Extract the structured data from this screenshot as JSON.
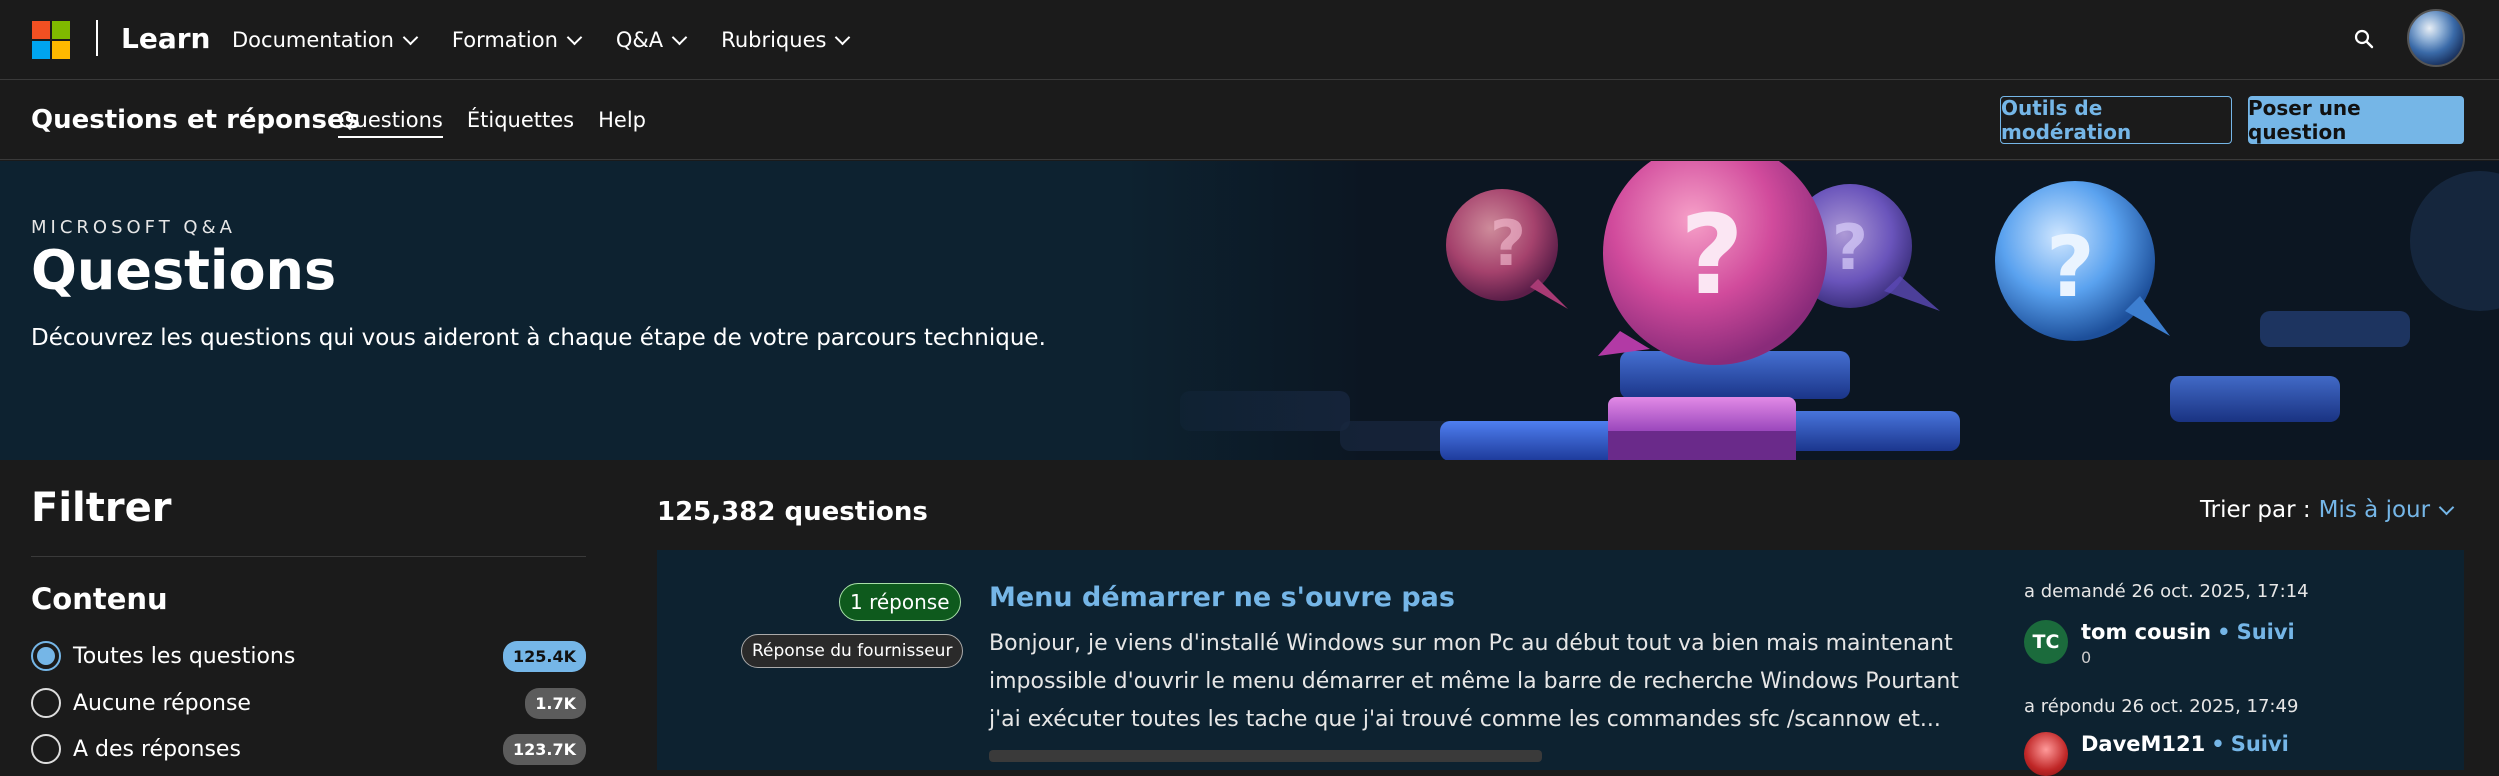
{
  "header": {
    "brand": "Learn",
    "logo_colors": [
      "#f25022",
      "#7fba00",
      "#00a4ef",
      "#ffb900"
    ],
    "nav": [
      {
        "label": "Documentation"
      },
      {
        "label": "Formation"
      },
      {
        "label": "Q&A"
      },
      {
        "label": "Rubriques"
      }
    ],
    "search_icon": "search-icon",
    "avatar": "avatar"
  },
  "subheader": {
    "title": "Questions et réponses",
    "tabs": [
      {
        "label": "Questions"
      },
      {
        "label": "Étiquettes"
      },
      {
        "label": "Help"
      }
    ],
    "moderation_button": "Outils de modération",
    "ask_button": "Poser une question"
  },
  "hero": {
    "eyebrow": "MICROSOFT Q&A",
    "title": "Questions",
    "description": "Découvrez les questions qui vous aideront à chaque étape de votre parcours technique."
  },
  "filter": {
    "title": "Filtrer",
    "section_title": "Contenu",
    "options": [
      {
        "label": "Toutes les questions",
        "count": "125.4K",
        "checked": true
      },
      {
        "label": "Aucune réponse",
        "count": "1.7K",
        "checked": false
      },
      {
        "label": "A des réponses",
        "count": "123.7K",
        "checked": false
      }
    ]
  },
  "results": {
    "count_label": "125,382 questions",
    "sort_label": "Trier par :",
    "sort_value": "Mis à jour"
  },
  "question": {
    "answers_badge": "1 réponse",
    "vendor_badge": "Réponse du fournisseur",
    "title": "Menu démarrer ne s'ouvre pas",
    "excerpt": "Bonjour, je viens d'installé Windows sur mon Pc au début tout va bien mais maintenant impossible d'ouvrir le menu démarrer et même la barre de recherche Windows Pourtant j'ai exécuter toutes les tache que j'ai trouvé comme les commandes sfc /scannow et...",
    "asked": "a demandé 26 oct. 2025, 17:14",
    "asker": {
      "initials": "TC",
      "name": "tom cousin",
      "follow": "Suivi",
      "score": "0"
    },
    "answered": "a répondu 26 oct. 2025, 17:49",
    "answerer": {
      "name": "DaveM121",
      "follow": "Suivi"
    }
  },
  "colors": {
    "accent": "#75b6e7",
    "page_bg": "#1b1b1b",
    "hero_bg": "#0d2230",
    "answer_badge_bg": "#0e5a1d"
  }
}
